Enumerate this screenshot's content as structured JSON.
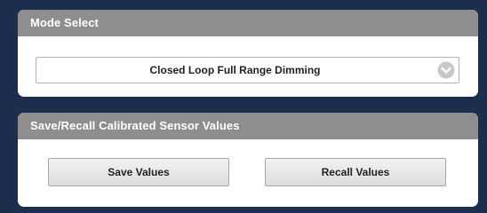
{
  "mode_select": {
    "header": "Mode Select",
    "selected": "Closed Loop Full Range Dimming",
    "dropdown_icon": "chevron-down-icon"
  },
  "calibration": {
    "header": "Save/Recall Calibrated Sensor Values",
    "save_label": "Save Values",
    "recall_label": "Recall Values"
  },
  "colors": {
    "background": "#1c2e4e",
    "panel": "#ffffff",
    "header": "#8e8e8e",
    "icon": "#c8c8c8"
  }
}
